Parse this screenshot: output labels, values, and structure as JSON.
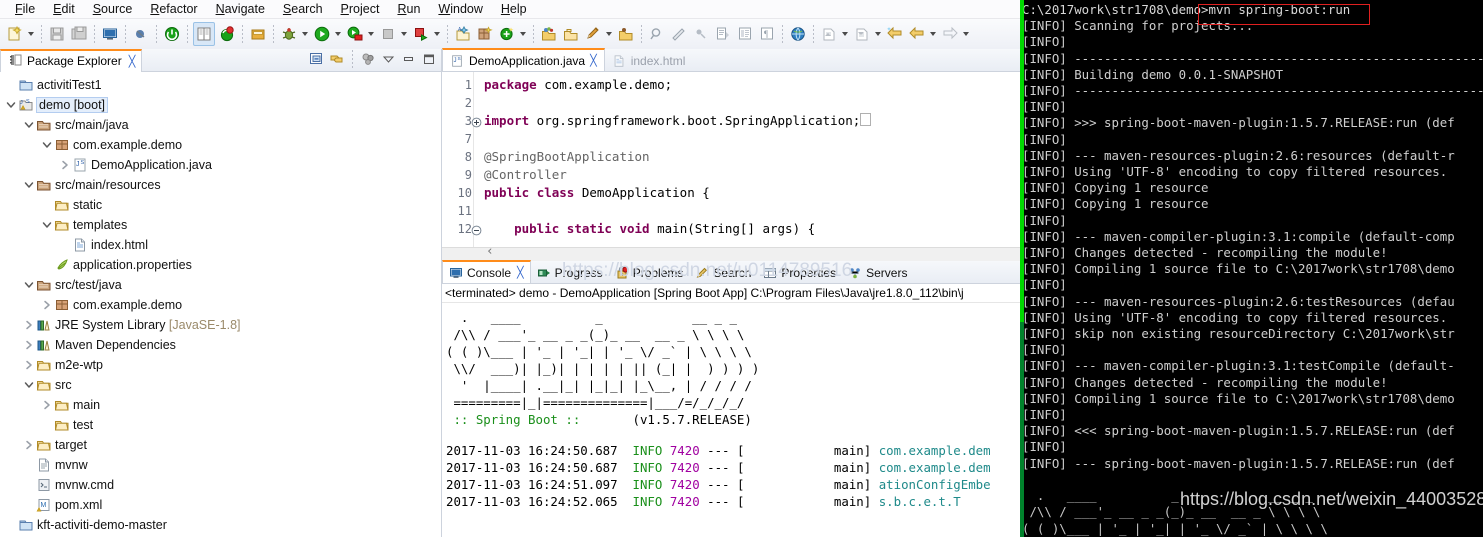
{
  "menu": {
    "items": [
      "File",
      "Edit",
      "Source",
      "Refactor",
      "Navigate",
      "Search",
      "Project",
      "Run",
      "Window",
      "Help"
    ]
  },
  "toolbar": {
    "icons": [
      "new-wizard-icon",
      "new-wizard-dropdown",
      "save-icon",
      "save-all-icon",
      "console-view-icon",
      "toggle-breakpoint-icon",
      "terminate-green-icon",
      "open-book-icon",
      "refresh-red-icon",
      "export-icon",
      "debug-icon",
      "debug-dropdown",
      "run-icon",
      "run-dropdown",
      "run-server-icon",
      "run-server-dropdown",
      "stop-icon",
      "stop-dropdown",
      "run-external-icon",
      "run-external-dropdown",
      "new-java-project-icon",
      "new-package-icon",
      "new-class-icon",
      "new-class-dropdown",
      "open-type-icon",
      "open-folder-icon",
      "edit-pencil-icon",
      "edit-dropdown",
      "open-resource-icon",
      "search-marker-icon",
      "ruler-icon",
      "annotation-icon",
      "next-edit-icon",
      "outline-icon",
      "paragraph-icon",
      "web-browser-icon",
      "previous-annotation-icon",
      "previous-annotation-dropdown",
      "next-annotation-icon",
      "next-annotation-dropdown",
      "back-history-icon",
      "back-icon",
      "back-dropdown",
      "forward-icon",
      "forward-dropdown"
    ]
  },
  "package_explorer": {
    "tab_label": "Package Explorer",
    "tab_close": "╳",
    "view_tools": [
      "collapse-all-icon",
      "link-with-editor-icon",
      "view-filter-icon",
      "view-menu-icon",
      "minimize-icon",
      "maximize-icon"
    ],
    "tree": [
      {
        "indent": 0,
        "twisty": "none",
        "icon": "project-closed-icon",
        "label": "activitiTest1",
        "selected": false
      },
      {
        "indent": 0,
        "twisty": "open",
        "icon": "java-project-icon",
        "label": "demo [boot]",
        "selected": true
      },
      {
        "indent": 1,
        "twisty": "open",
        "icon": "source-folder-icon",
        "label": "src/main/java",
        "selected": false
      },
      {
        "indent": 2,
        "twisty": "open",
        "icon": "package-icon",
        "label": "com.example.demo",
        "selected": false
      },
      {
        "indent": 3,
        "twisty": "closed",
        "icon": "java-file-icon",
        "label": "DemoApplication.java",
        "selected": false
      },
      {
        "indent": 1,
        "twisty": "open",
        "icon": "source-folder-icon",
        "label": "src/main/resources",
        "selected": false
      },
      {
        "indent": 2,
        "twisty": "none",
        "icon": "folder-icon",
        "label": "static",
        "selected": false
      },
      {
        "indent": 2,
        "twisty": "open",
        "icon": "folder-icon",
        "label": "templates",
        "selected": false
      },
      {
        "indent": 3,
        "twisty": "none",
        "icon": "html-file-icon",
        "label": "index.html",
        "selected": false
      },
      {
        "indent": 2,
        "twisty": "none",
        "icon": "properties-file-icon",
        "label": "application.properties",
        "selected": false
      },
      {
        "indent": 1,
        "twisty": "open",
        "icon": "source-folder-icon",
        "label": "src/test/java",
        "selected": false
      },
      {
        "indent": 2,
        "twisty": "closed",
        "icon": "package-icon",
        "label": "com.example.demo",
        "selected": false
      },
      {
        "indent": 1,
        "twisty": "closed",
        "icon": "library-icon",
        "label": "JRE System Library",
        "suffix": "[JavaSE-1.8]",
        "selected": false
      },
      {
        "indent": 1,
        "twisty": "closed",
        "icon": "library-icon",
        "label": "Maven Dependencies",
        "selected": false
      },
      {
        "indent": 1,
        "twisty": "closed",
        "icon": "folder-icon",
        "label": "m2e-wtp",
        "selected": false
      },
      {
        "indent": 1,
        "twisty": "open",
        "icon": "folder-icon",
        "label": "src",
        "selected": false
      },
      {
        "indent": 2,
        "twisty": "closed",
        "icon": "folder-icon",
        "label": "main",
        "selected": false
      },
      {
        "indent": 2,
        "twisty": "none",
        "icon": "folder-icon",
        "label": "test",
        "selected": false
      },
      {
        "indent": 1,
        "twisty": "closed",
        "icon": "folder-icon",
        "label": "target",
        "selected": false
      },
      {
        "indent": 1,
        "twisty": "none",
        "icon": "text-file-icon",
        "label": "mvnw",
        "selected": false
      },
      {
        "indent": 1,
        "twisty": "none",
        "icon": "cmd-file-icon",
        "label": "mvnw.cmd",
        "selected": false
      },
      {
        "indent": 1,
        "twisty": "none",
        "icon": "maven-pom-icon",
        "label": "pom.xml",
        "selected": false
      },
      {
        "indent": 0,
        "twisty": "none",
        "icon": "project-closed-icon",
        "label": "kft-activiti-demo-master",
        "selected": false
      }
    ]
  },
  "editor": {
    "tabs": [
      {
        "label": "DemoApplication.java",
        "icon": "java-file-icon",
        "active": true,
        "close": "╳"
      },
      {
        "label": "index.html",
        "icon": "html-file-icon",
        "active": false,
        "close": ""
      }
    ],
    "lines": [
      {
        "num": "1",
        "fold": "none",
        "text": "package com.example.demo;"
      },
      {
        "num": "2",
        "fold": "none",
        "text": ""
      },
      {
        "num": "3",
        "fold": "collapsed",
        "text": "import org.springframework.boot.SpringApplication;"
      },
      {
        "num": "7",
        "fold": "none",
        "text": ""
      },
      {
        "num": "8",
        "fold": "none",
        "text": "@SpringBootApplication"
      },
      {
        "num": "9",
        "fold": "none",
        "text": "@Controller"
      },
      {
        "num": "10",
        "fold": "none",
        "text": "public class DemoApplication {"
      },
      {
        "num": "11",
        "fold": "none",
        "text": ""
      },
      {
        "num": "12",
        "fold": "expanded",
        "text": "    public static void main(String[] args) {"
      }
    ]
  },
  "console": {
    "tabs": [
      {
        "label": "Console",
        "icon": "console-icon",
        "active": true,
        "close": "╳"
      },
      {
        "label": "Progress",
        "icon": "progress-icon",
        "active": false,
        "close": ""
      },
      {
        "label": "Problems",
        "icon": "problems-icon",
        "active": false,
        "close": ""
      },
      {
        "label": "Search",
        "icon": "search-icon",
        "active": false,
        "close": ""
      },
      {
        "label": "Properties",
        "icon": "properties-icon",
        "active": false,
        "close": ""
      },
      {
        "label": "Servers",
        "icon": "servers-icon",
        "active": false,
        "close": ""
      }
    ],
    "status_line": "<terminated> demo - DemoApplication [Spring Boot App] C:\\Program Files\\Java\\jre1.8.0_112\\bin\\j",
    "watermark": "https://blog.csdn.net/u0114789516",
    "banner": [
      "  .   ____          _            __ _ _",
      " /\\\\ / ___'_ __ _ _(_)_ __  __ _ \\ \\ \\ \\",
      "( ( )\\___ | '_ | '_| | '_ \\/ _` | \\ \\ \\ \\",
      " \\\\/  ___)| |_)| | | | | || (_| |  ) ) ) )",
      "  '  |____| .__|_| |_|_| |_\\__, | / / / /",
      " =========|_|==============|___/=/_/_/_/"
    ],
    "banner_footer_left": " :: Spring Boot ::",
    "banner_footer_right": "       (v1.5.7.RELEASE)",
    "logs": [
      {
        "date": "2017-11-03 16:24:50.687",
        "level": "INFO",
        "pid": "7420",
        "sep": "--- [",
        "thread": "            main]",
        "logger": "com.example.dem"
      },
      {
        "date": "2017-11-03 16:24:50.687",
        "level": "INFO",
        "pid": "7420",
        "sep": "--- [",
        "thread": "            main]",
        "logger": "com.example.dem"
      },
      {
        "date": "2017-11-03 16:24:51.097",
        "level": "INFO",
        "pid": "7420",
        "sep": "--- [",
        "thread": "            main]",
        "logger": "ationConfigEmbe"
      },
      {
        "date": "2017-11-03 16:24:52.065",
        "level": "INFO",
        "pid": "7420",
        "sep": "--- [",
        "thread": "            main]",
        "logger": "s.b.c.e.t.T"
      }
    ]
  },
  "terminal": {
    "prompt": "C:\\2017work\\str1708\\demo>",
    "command": "mvn spring-boot:run",
    "highlight_color": "#e02020",
    "watermark": "https://blog.csdn.net/weixin_44003528",
    "lines": [
      "[INFO] Scanning for projects...",
      "[INFO]",
      "[INFO] ------------------------------------------------------------",
      "[INFO] Building demo 0.0.1-SNAPSHOT",
      "[INFO] ------------------------------------------------------------",
      "[INFO]",
      "[INFO] >>> spring-boot-maven-plugin:1.5.7.RELEASE:run (def",
      "[INFO]",
      "[INFO] --- maven-resources-plugin:2.6:resources (default-r",
      "[INFO] Using 'UTF-8' encoding to copy filtered resources.",
      "[INFO] Copying 1 resource",
      "[INFO] Copying 1 resource",
      "[INFO]",
      "[INFO] --- maven-compiler-plugin:3.1:compile (default-comp",
      "[INFO] Changes detected - recompiling the module!",
      "[INFO] Compiling 1 source file to C:\\2017work\\str1708\\demo",
      "[INFO]",
      "[INFO] --- maven-resources-plugin:2.6:testResources (defau",
      "[INFO] Using 'UTF-8' encoding to copy filtered resources.",
      "[INFO] skip non existing resourceDirectory C:\\2017work\\str",
      "[INFO]",
      "[INFO] --- maven-compiler-plugin:3.1:testCompile (default-",
      "[INFO] Changes detected - recompiling the module!",
      "[INFO] Compiling 1 source file to C:\\2017work\\str1708\\demo",
      "[INFO]",
      "[INFO] <<< spring-boot-maven-plugin:1.5.7.RELEASE:run (def",
      "[INFO]",
      "[INFO] --- spring-boot-maven-plugin:1.5.7.RELEASE:run (def",
      ""
    ],
    "banner": [
      "  .   ____          _            __ _ _",
      " /\\\\ / ___'_ __ _ _(_)_ __  __ _ \\ \\ \\ \\",
      "( ( )\\___ | '_ | '_| | '_ \\/ _` | \\ \\ \\ \\"
    ]
  }
}
